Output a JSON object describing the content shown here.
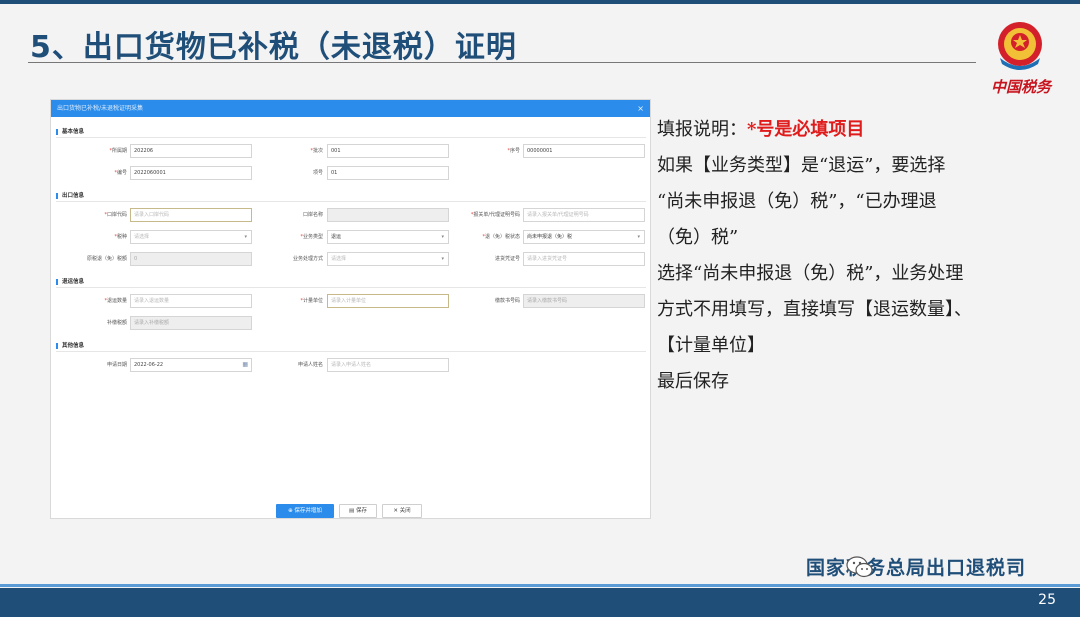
{
  "slide": {
    "title": "5、出口货物已补税（未退税）证明",
    "emblem_text": "中国税务",
    "page_number": "25",
    "footer_brand": "国家税务总局出口退税司",
    "colors": {
      "primary": "#1f4e79",
      "accent": "#2b8ceb",
      "required": "#e01b1b"
    }
  },
  "dialog": {
    "title": "出口货物已补税/未退税证明采集",
    "close_icon": "close-icon",
    "sections": {
      "basic": "基本信息",
      "export": "出口信息",
      "return": "退运信息",
      "other": "其他信息"
    },
    "fields": {
      "period_label": "所属期",
      "period_value": "202206",
      "batch_label": "批次",
      "batch_value": "001",
      "seq_label": "序号",
      "seq_value": "00000001",
      "code_label": "编号",
      "code_value": "2022060001",
      "item_label": "项号",
      "item_value": "01",
      "port_code_label": "口岸代码",
      "port_code_placeholder": "请录入口岸代码",
      "port_name_label": "口岸名称",
      "customs_no_label": "报关单/代理证明号码",
      "customs_no_placeholder": "请录入报关单/代理证明号码",
      "tax_type_label": "税种",
      "tax_type_placeholder": "请选择",
      "biz_type_label": "业务类型",
      "biz_type_value": "退运",
      "refund_status_label": "退（免）税状态",
      "refund_status_value": "尚未申报退（免）税",
      "orig_refund_label": "原税退（免）税额",
      "orig_refund_value": "0",
      "handling_label": "业务处理方式",
      "handling_placeholder": "请选择",
      "invoice_label": "进货凭证号",
      "invoice_placeholder": "请录入进货凭证号",
      "return_qty_label": "退运数量",
      "return_qty_placeholder": "请录入退运数量",
      "unit_label": "计量单位",
      "unit_placeholder": "请录入计量单位",
      "certificate_label": "缴款书号码",
      "certificate_placeholder": "请录入缴款书号码",
      "supplement_label": "补缴税额",
      "supplement_placeholder": "请录入补缴税额",
      "apply_date_label": "申请日期",
      "apply_date_value": "2022-06-22",
      "applicant_label": "申请人姓名",
      "applicant_placeholder": "请录入申请人姓名"
    },
    "buttons": {
      "save_add": "保存并增加",
      "save": "保存",
      "close": "关闭"
    }
  },
  "notes": {
    "prefix": "填报说明：",
    "required_note": "*号是必填项目",
    "line1": "如果【业务类型】是“退运”，要选择",
    "line2": "“尚未申报退（免）税”，“已办理退",
    "line3": "（免）税”",
    "line4": "选择“尚未申报退（免）税”，业务处理",
    "line5": "方式不用填写，直接填写【退运数量】、",
    "line6": "【计量单位】",
    "line7": "最后保存"
  }
}
